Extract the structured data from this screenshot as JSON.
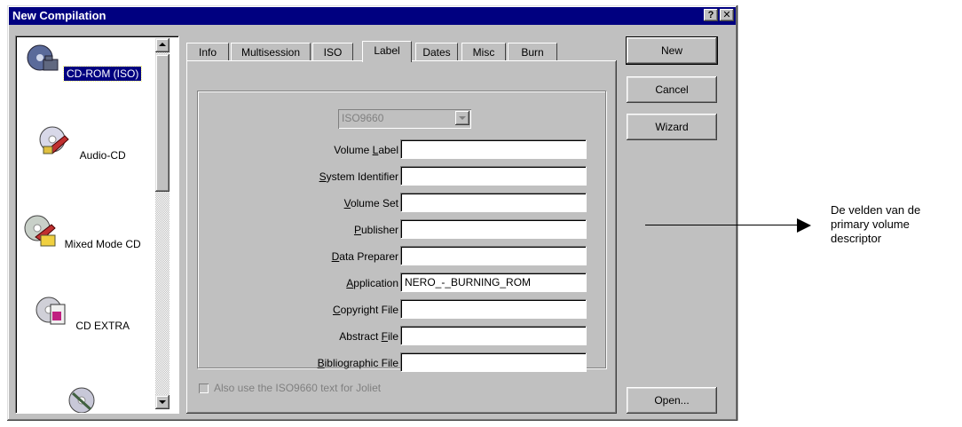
{
  "window": {
    "title": "New Compilation",
    "help_label": "?",
    "close_label": "✕"
  },
  "sidebar": {
    "items": [
      {
        "label": "CD-ROM (ISO)",
        "icon": "cd-rom-iso-icon",
        "selected": true
      },
      {
        "label": "Audio-CD",
        "icon": "audio-cd-icon",
        "selected": false
      },
      {
        "label": "Mixed Mode CD",
        "icon": "mixed-mode-cd-icon",
        "selected": false
      },
      {
        "label": "CD EXTRA",
        "icon": "cd-extra-icon",
        "selected": false
      },
      {
        "label": "",
        "icon": "cd-icon",
        "selected": false
      }
    ]
  },
  "tabs": [
    {
      "label": "Info"
    },
    {
      "label": "Multisession"
    },
    {
      "label": "ISO"
    },
    {
      "label": "Label",
      "active": true
    },
    {
      "label": "Dates"
    },
    {
      "label": "Misc"
    },
    {
      "label": "Burn"
    }
  ],
  "label_tab": {
    "format_select": "ISO9660",
    "fields": [
      {
        "pre": "Volume ",
        "key": "L",
        "post": "abel",
        "value": ""
      },
      {
        "pre": "",
        "key": "S",
        "post": "ystem Identifier",
        "value": ""
      },
      {
        "pre": "",
        "key": "V",
        "post": "olume Set",
        "value": ""
      },
      {
        "pre": "",
        "key": "P",
        "post": "ublisher",
        "value": ""
      },
      {
        "pre": "",
        "key": "D",
        "post": "ata Preparer",
        "value": ""
      },
      {
        "pre": "",
        "key": "A",
        "post": "pplication",
        "value": "NERO_-_BURNING_ROM"
      },
      {
        "pre": "",
        "key": "C",
        "post": "opyright File",
        "value": ""
      },
      {
        "pre": "Abstract ",
        "key": "F",
        "post": "ile",
        "value": ""
      },
      {
        "pre": "",
        "key": "B",
        "post": "ibliographic File",
        "value": ""
      }
    ],
    "joliet_checkbox": "Also use the ISO9660 text for Joliet"
  },
  "buttons": {
    "new": "New",
    "cancel": "Cancel",
    "wizard": "Wizard",
    "open": "Open..."
  },
  "annotation": {
    "text": "De velden van de primary volume descriptor"
  }
}
